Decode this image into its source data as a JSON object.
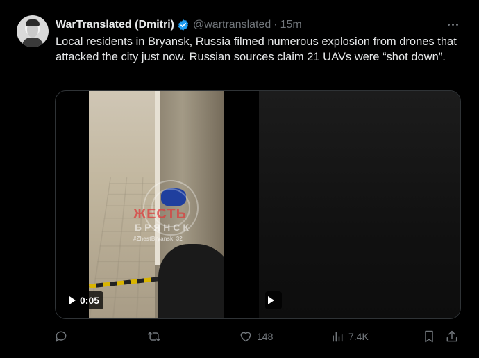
{
  "tweet": {
    "display_name": "WarTranslated (Dmitri)",
    "handle": "@wartranslated",
    "separator": "·",
    "time": "15m",
    "text": "Local residents in Bryansk, Russia filmed numerous explosion from drones that attacked the city just now. Russian sources claim 21 UAVs were “shot down”."
  },
  "media": {
    "video1": {
      "duration": "0:05",
      "watermark_line1": "ЖЕСТЬ",
      "watermark_line2": "БРЯНСК",
      "watermark_line3": "#ZhestBryansk_32"
    },
    "video2": {
      "duration": ""
    }
  },
  "actions": {
    "reply_count": "",
    "retweet_count": "",
    "like_count": "148",
    "view_count": "7.4K"
  },
  "colors": {
    "background": "#000000",
    "text": "#e7e9ea",
    "muted": "#71767b",
    "verified": "#1d9bf0",
    "border": "#2f3336"
  },
  "icons": [
    "verified-badge-icon",
    "more-icon",
    "play-icon",
    "reply-icon",
    "retweet-icon",
    "like-icon",
    "views-icon",
    "bookmark-icon",
    "share-icon"
  ]
}
